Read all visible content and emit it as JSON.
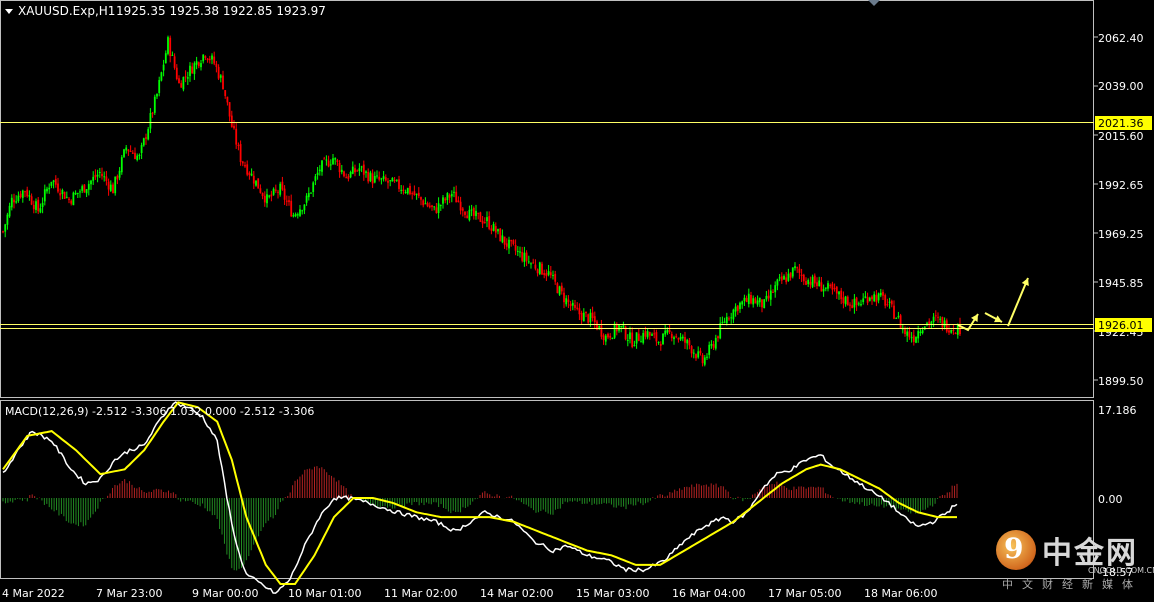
{
  "header": {
    "symbol_info": "XAUUSD.Exp,H1",
    "ohlc": "1925.35 1925.38 1922.85 1923.97"
  },
  "price_axis": {
    "labels": [
      "2062.40",
      "2039.00",
      "2015.60",
      "1992.65",
      "1969.25",
      "1945.85",
      "1922.45",
      "1899.50"
    ],
    "marker_upper": "2021.36",
    "marker_current": "1926.01"
  },
  "macd_panel": {
    "title": "MACD(12,26,9) -2.512 -3.306 1.032 0.000 -2.512 -3.306",
    "axis_labels": [
      "17.186",
      "0.00",
      "-18.57"
    ]
  },
  "time_axis": {
    "labels": [
      "4 Mar 2022",
      "7 Mar 23:00",
      "9 Mar 00:00",
      "10 Mar 01:00",
      "11 Mar 02:00",
      "14 Mar 02:00",
      "15 Mar 03:00",
      "16 Mar 04:00",
      "17 Mar 05:00",
      "18 Mar 06:00"
    ]
  },
  "colors": {
    "background": "#000000",
    "grid_border": "#c0c0c0",
    "bull": "#00ff00",
    "bear": "#ff0000",
    "level_line": "#ffff66",
    "marker_bg": "#ffff00",
    "macd_line": "#ffffff",
    "signal_line": "#ffff00",
    "hist_pos": "#b22222",
    "hist_neg": "#228b22"
  },
  "chart_data": {
    "type": "candlestick",
    "symbol": "XAUUSD.Exp",
    "timeframe": "H1",
    "ylim": [
      1890,
      2080
    ],
    "horizontal_levels": [
      2021.36,
      1926.01
    ],
    "anchor_closes": [
      [
        0,
        1970
      ],
      [
        4,
        1985
      ],
      [
        10,
        1990
      ],
      [
        16,
        1980
      ],
      [
        22,
        1995
      ],
      [
        30,
        1985
      ],
      [
        38,
        1992
      ],
      [
        44,
        1998
      ],
      [
        50,
        1990
      ],
      [
        56,
        2010
      ],
      [
        62,
        2005
      ],
      [
        70,
        2035
      ],
      [
        75,
        2060
      ],
      [
        80,
        2040
      ],
      [
        86,
        2048
      ],
      [
        92,
        2055
      ],
      [
        96,
        2050
      ],
      [
        100,
        2040
      ],
      [
        104,
        2020
      ],
      [
        108,
        2005
      ],
      [
        114,
        1995
      ],
      [
        120,
        1985
      ],
      [
        126,
        1990
      ],
      [
        132,
        1978
      ],
      [
        138,
        1985
      ],
      [
        144,
        2000
      ],
      [
        150,
        2005
      ],
      [
        156,
        1996
      ],
      [
        162,
        2000
      ],
      [
        168,
        1995
      ],
      [
        176,
        1993
      ],
      [
        184,
        1990
      ],
      [
        190,
        1985
      ],
      [
        196,
        1980
      ],
      [
        204,
        1988
      ],
      [
        212,
        1978
      ],
      [
        220,
        1975
      ],
      [
        228,
        1965
      ],
      [
        234,
        1960
      ],
      [
        240,
        1955
      ],
      [
        248,
        1950
      ],
      [
        254,
        1940
      ],
      [
        260,
        1932
      ],
      [
        268,
        1928
      ],
      [
        274,
        1920
      ],
      [
        280,
        1925
      ],
      [
        286,
        1918
      ],
      [
        292,
        1922
      ],
      [
        298,
        1918
      ],
      [
        304,
        1922
      ],
      [
        312,
        1916
      ],
      [
        318,
        1908
      ],
      [
        322,
        1915
      ],
      [
        328,
        1928
      ],
      [
        334,
        1935
      ],
      [
        340,
        1938
      ],
      [
        346,
        1935
      ],
      [
        352,
        1945
      ],
      [
        356,
        1948
      ],
      [
        360,
        1952
      ],
      [
        364,
        1948
      ],
      [
        370,
        1945
      ],
      [
        376,
        1942
      ],
      [
        382,
        1938
      ],
      [
        388,
        1935
      ],
      [
        394,
        1940
      ],
      [
        400,
        1938
      ],
      [
        406,
        1930
      ],
      [
        410,
        1922
      ],
      [
        414,
        1920
      ],
      [
        418,
        1926
      ],
      [
        424,
        1928
      ],
      [
        430,
        1925
      ],
      [
        435,
        1924
      ]
    ],
    "projection_arrows": [
      [
        [
          958,
          325
        ],
        [
          968,
          330
        ],
        [
          978,
          314
        ]
      ],
      [
        [
          985,
          313
        ],
        [
          1002,
          322
        ]
      ],
      [
        [
          1008,
          326
        ],
        [
          1028,
          278
        ]
      ]
    ],
    "macd": {
      "ylim": [
        -22,
        22
      ],
      "line_anchors": [
        [
          0,
          5
        ],
        [
          6,
          10
        ],
        [
          12,
          14
        ],
        [
          20,
          12
        ],
        [
          28,
          6
        ],
        [
          34,
          3
        ],
        [
          40,
          4
        ],
        [
          46,
          8
        ],
        [
          52,
          10
        ],
        [
          58,
          11
        ],
        [
          64,
          16
        ],
        [
          70,
          20
        ],
        [
          76,
          19
        ],
        [
          82,
          17
        ],
        [
          88,
          12
        ],
        [
          92,
          0
        ],
        [
          96,
          -10
        ],
        [
          100,
          -16
        ],
        [
          106,
          -18
        ],
        [
          112,
          -20
        ],
        [
          118,
          -17
        ],
        [
          124,
          -10
        ],
        [
          130,
          -4
        ],
        [
          136,
          0
        ],
        [
          142,
          0
        ],
        [
          150,
          -1
        ],
        [
          156,
          -2
        ],
        [
          162,
          -3
        ],
        [
          170,
          -4
        ],
        [
          178,
          -5
        ],
        [
          186,
          -7
        ],
        [
          192,
          -5
        ],
        [
          198,
          -3
        ],
        [
          204,
          -4
        ],
        [
          210,
          -5
        ],
        [
          218,
          -9
        ],
        [
          226,
          -11
        ],
        [
          232,
          -10
        ],
        [
          240,
          -12
        ],
        [
          248,
          -13
        ],
        [
          256,
          -15
        ],
        [
          264,
          -15
        ],
        [
          272,
          -13
        ],
        [
          280,
          -9
        ],
        [
          288,
          -6
        ],
        [
          296,
          -4
        ],
        [
          300,
          -5
        ],
        [
          306,
          -3
        ],
        [
          312,
          2
        ],
        [
          318,
          5
        ],
        [
          324,
          6
        ],
        [
          330,
          8
        ],
        [
          336,
          9
        ],
        [
          340,
          7
        ],
        [
          346,
          5
        ],
        [
          352,
          3
        ],
        [
          358,
          1
        ],
        [
          364,
          -1
        ],
        [
          370,
          -4
        ],
        [
          376,
          -6
        ],
        [
          382,
          -5
        ],
        [
          388,
          -3
        ],
        [
          392,
          -1
        ]
      ],
      "signal_anchors": [
        [
          0,
          6
        ],
        [
          10,
          13
        ],
        [
          20,
          14
        ],
        [
          30,
          10
        ],
        [
          40,
          5
        ],
        [
          50,
          6
        ],
        [
          58,
          10
        ],
        [
          66,
          16
        ],
        [
          72,
          20
        ],
        [
          80,
          19
        ],
        [
          88,
          16
        ],
        [
          94,
          8
        ],
        [
          100,
          -4
        ],
        [
          108,
          -14
        ],
        [
          114,
          -18
        ],
        [
          120,
          -18
        ],
        [
          128,
          -12
        ],
        [
          136,
          -4
        ],
        [
          144,
          0
        ],
        [
          152,
          0
        ],
        [
          160,
          -1
        ],
        [
          170,
          -3
        ],
        [
          180,
          -4
        ],
        [
          190,
          -4
        ],
        [
          200,
          -4
        ],
        [
          210,
          -5
        ],
        [
          220,
          -7
        ],
        [
          230,
          -9
        ],
        [
          240,
          -11
        ],
        [
          250,
          -12
        ],
        [
          260,
          -14
        ],
        [
          270,
          -14
        ],
        [
          280,
          -11
        ],
        [
          290,
          -8
        ],
        [
          300,
          -5
        ],
        [
          310,
          -1
        ],
        [
          320,
          3
        ],
        [
          330,
          6
        ],
        [
          336,
          7
        ],
        [
          344,
          6
        ],
        [
          352,
          4
        ],
        [
          360,
          2
        ],
        [
          368,
          -1
        ],
        [
          376,
          -3
        ],
        [
          384,
          -4
        ],
        [
          392,
          -4
        ]
      ]
    }
  }
}
